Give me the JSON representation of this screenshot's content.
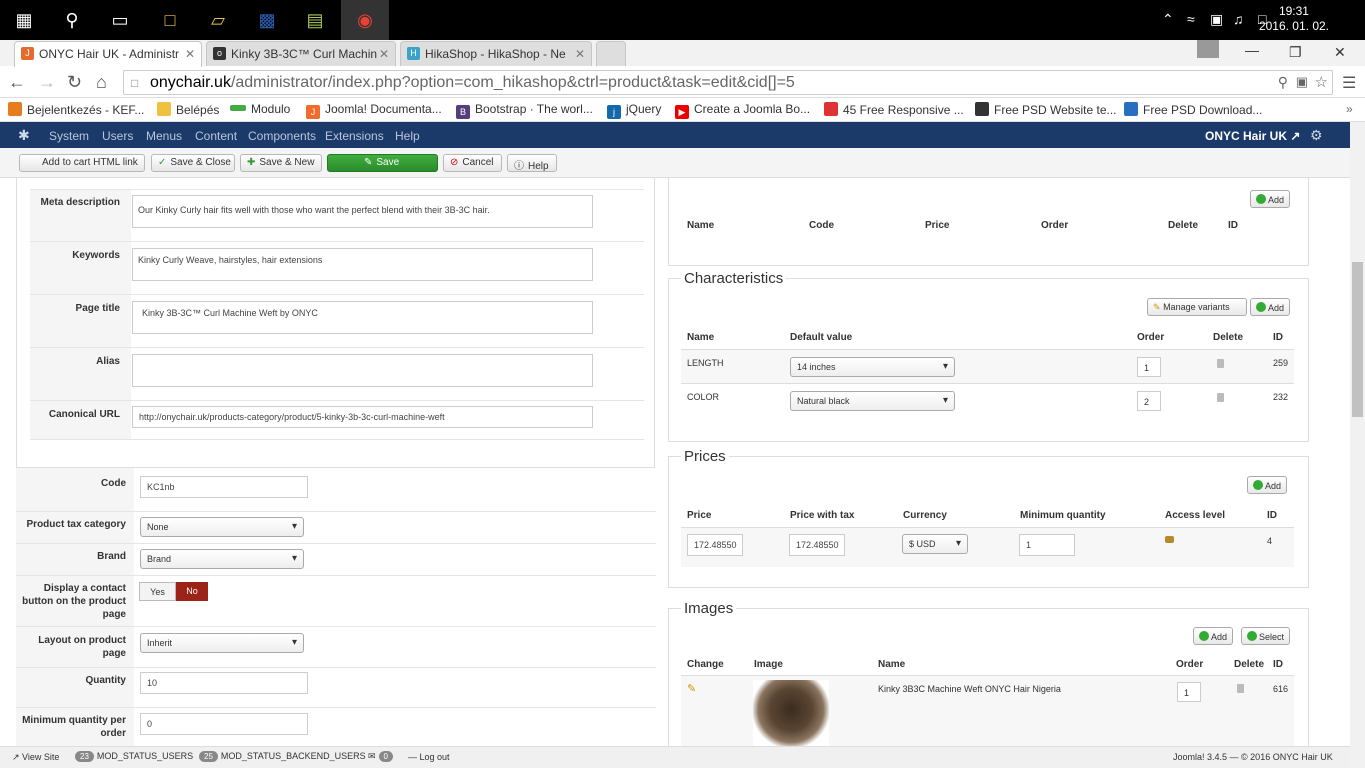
{
  "taskbar": {
    "time": "19:31",
    "date": "2016. 01. 02."
  },
  "browser": {
    "tabs": [
      {
        "title": "ONYC Hair UK - Administr",
        "active": true
      },
      {
        "title": "Kinky 3B-3C™ Curl Machin",
        "active": false
      },
      {
        "title": "HikaShop - HikaShop - Ne",
        "active": false
      }
    ],
    "url_host": "onychair.uk",
    "url_path": "/administrator/index.php?option=com_hikashop&ctrl=product&task=edit&cid[]=5",
    "bookmarks": [
      "Bejelentkezés - KEF...",
      "Belépés",
      "Modulo",
      "Joomla! Documenta...",
      "Bootstrap · The worl...",
      "jQuery",
      "Create a Joomla Bo...",
      "45 Free Responsive ...",
      "Free PSD Website te...",
      "Free PSD Download..."
    ]
  },
  "joomla_menu": {
    "items": [
      "System",
      "Users",
      "Menus",
      "Content",
      "Components",
      "Extensions",
      "Help"
    ],
    "site_name": "ONYC Hair UK"
  },
  "toolbar": {
    "add_to_cart": "Add to cart HTML link",
    "save_close": "Save & Close",
    "save_new": "Save & New",
    "save": "Save",
    "cancel": "Cancel",
    "help": "Help"
  },
  "meta": {
    "meta_description_label": "Meta description",
    "meta_description": "Our Kinky Curly hair fits well with those who want the perfect blend with their 3B-3C hair.",
    "keywords_label": "Keywords",
    "keywords": "Kinky Curly Weave, hairstyles, hair extensions",
    "page_title_label": "Page title",
    "page_title": "Kinky 3B-3C™ Curl Machine Weft by ONYC",
    "alias_label": "Alias",
    "alias": "",
    "canonical_label": "Canonical URL",
    "canonical": "http://onychair.uk/products-category/product/5-kinky-3b-3c-curl-machine-weft"
  },
  "product": {
    "code_label": "Code",
    "code": "KC1nb",
    "tax_label": "Product tax category",
    "tax": "None",
    "brand_label": "Brand",
    "brand": "Brand",
    "contact_label": "Display a contact button on the product page",
    "yes": "Yes",
    "no": "No",
    "layout_label": "Layout on product page",
    "layout": "Inherit",
    "quantity_label": "Quantity",
    "quantity": "10",
    "minqty_label": "Minimum quantity per order",
    "minqty": "0"
  },
  "related": {
    "add": "Add",
    "headers": [
      "Name",
      "Code",
      "Price",
      "Order",
      "Delete",
      "ID"
    ]
  },
  "characteristics": {
    "legend": "Characteristics",
    "manage_variants": "Manage variants",
    "add": "Add",
    "headers": [
      "Name",
      "Default value",
      "Order",
      "Delete",
      "ID"
    ],
    "rows": [
      {
        "name": "LENGTH",
        "value": "14 inches",
        "order": "1",
        "id": "259"
      },
      {
        "name": "COLOR",
        "value": "Natural black",
        "order": "2",
        "id": "232"
      }
    ]
  },
  "prices": {
    "legend": "Prices",
    "add": "Add",
    "headers": [
      "Price",
      "Price with tax",
      "Currency",
      "Minimum quantity",
      "Access level",
      "ID"
    ],
    "row": {
      "price": "172.48550",
      "price_tax": "172.48550",
      "currency": "$ USD",
      "min_qty": "1",
      "id": "4"
    }
  },
  "images": {
    "legend": "Images",
    "add": "Add",
    "select": "Select",
    "headers": [
      "Change",
      "Image",
      "Name",
      "Order",
      "Delete",
      "ID"
    ],
    "row": {
      "name": "Kinky 3B3C Machine Weft ONYC Hair Nigeria",
      "order": "1",
      "id": "616"
    }
  },
  "status": {
    "view_site": "View Site",
    "users_count": "23",
    "users": "MOD_STATUS_USERS",
    "backend_count": "25",
    "backend": "MOD_STATUS_BACKEND_USERS",
    "msg_count": "0",
    "logout": "Log out",
    "version": "Joomla! 3.4.5",
    "copyright": "© 2016 ONYC Hair UK"
  },
  "colors": {
    "joomla_nav": "#1b3a6a",
    "save_green": "#2e952e",
    "no_red": "#9b2318"
  }
}
